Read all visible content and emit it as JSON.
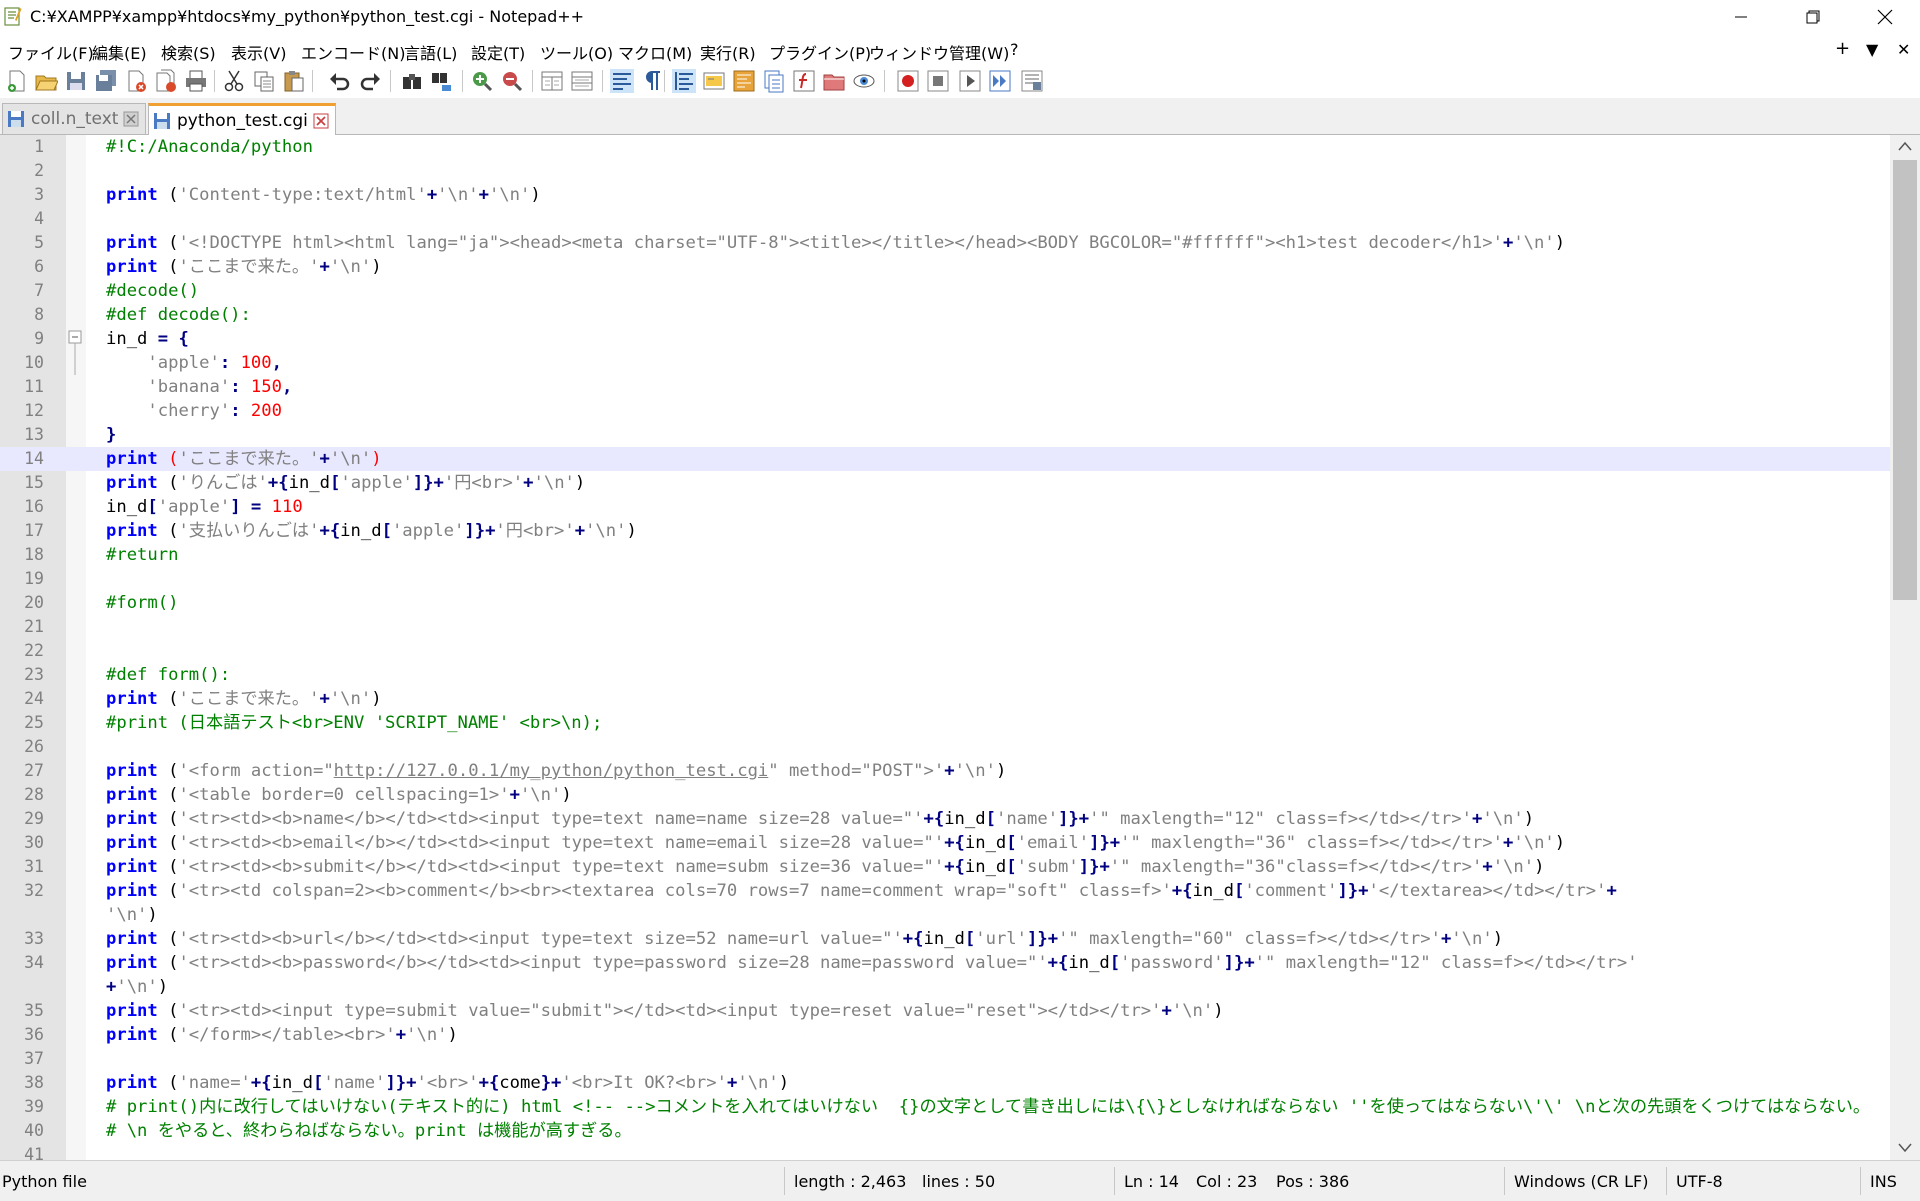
{
  "window": {
    "title": "C:¥XAMPP¥xampp¥htdocs¥my_python¥python_test.cgi - Notepad++",
    "minimize_icon": "minimize-icon",
    "maximize_icon": "restore-icon",
    "close_icon": "close-icon"
  },
  "menu": {
    "items": [
      "ファイル(F)",
      "編集(E)",
      "検索(S)",
      "表示(V)",
      "エンコード(N)",
      "言語(L)",
      "設定(T)",
      "ツール(O)",
      "マクロ(M)",
      "実行(R)",
      "プラグイン(P)",
      "ウィンドウ管理(W)",
      "?"
    ],
    "right_plus": "+",
    "right_down": "▼",
    "right_close": "✕"
  },
  "toolbar": {
    "icons": [
      "new-file-icon",
      "open-file-icon",
      "save-icon",
      "save-all-icon",
      "close-icon",
      "close-all-icon",
      "print-icon",
      "cut-icon",
      "copy-icon",
      "paste-icon",
      "undo-icon",
      "redo-icon",
      "find-icon",
      "replace-icon",
      "zoom-in-icon",
      "zoom-out-icon",
      "sync-vertical-icon",
      "sync-horizontal-icon",
      "word-wrap-icon",
      "show-all-chars-icon",
      "indent-guide-icon",
      "language-udl-icon",
      "doc-map-icon",
      "doc-list-icon",
      "function-list-icon",
      "folder-workspace-icon",
      "monitoring-icon",
      "record-macro-icon",
      "stop-record-icon",
      "play-macro-icon",
      "run-macro-multiple-icon",
      "save-macro-icon"
    ]
  },
  "tabs": [
    {
      "label": "coll.n_text",
      "active": false
    },
    {
      "label": "python_test.cgi",
      "active": true
    }
  ],
  "editor": {
    "current_line": 14,
    "fold_start_line": 9,
    "lines": [
      {
        "n": "1",
        "segs": [
          [
            "cm",
            "#!C:/Anaconda/python"
          ]
        ]
      },
      {
        "n": "2",
        "segs": []
      },
      {
        "n": "3",
        "segs": [
          [
            "kw",
            "print"
          ],
          [
            "df",
            " ("
          ],
          [
            "st",
            "'Content-type:text/html'"
          ],
          [
            "op",
            "+"
          ],
          [
            "st",
            "'\\n'"
          ],
          [
            "op",
            "+"
          ],
          [
            "st",
            "'\\n'"
          ],
          [
            "df",
            ")"
          ]
        ]
      },
      {
        "n": "4",
        "segs": []
      },
      {
        "n": "5",
        "segs": [
          [
            "kw",
            "print"
          ],
          [
            "df",
            " ("
          ],
          [
            "st",
            "'<!DOCTYPE html><html lang=\"ja\"><head><meta charset=\"UTF-8\"><title></title></head><BODY BGCOLOR=\"#ffffff\"><h1>test decoder</h1>'"
          ],
          [
            "op",
            "+"
          ],
          [
            "st",
            "'\\n'"
          ],
          [
            "df",
            ")"
          ]
        ]
      },
      {
        "n": "6",
        "segs": [
          [
            "kw",
            "print"
          ],
          [
            "df",
            " ("
          ],
          [
            "st",
            "'ここまで来た。'"
          ],
          [
            "op",
            "+"
          ],
          [
            "st",
            "'\\n'"
          ],
          [
            "df",
            ")"
          ]
        ]
      },
      {
        "n": "7",
        "segs": [
          [
            "cm",
            "#decode()"
          ]
        ]
      },
      {
        "n": "8",
        "segs": [
          [
            "cm",
            "#def decode():"
          ]
        ]
      },
      {
        "n": "9",
        "segs": [
          [
            "df",
            "in_d "
          ],
          [
            "op",
            "="
          ],
          [
            "df",
            " "
          ],
          [
            "op",
            "{"
          ]
        ]
      },
      {
        "n": "10",
        "segs": [
          [
            "df",
            "    "
          ],
          [
            "st",
            "'apple'"
          ],
          [
            "op",
            ":"
          ],
          [
            "df",
            " "
          ],
          [
            "nm",
            "100"
          ],
          [
            "op",
            ","
          ]
        ]
      },
      {
        "n": "11",
        "segs": [
          [
            "df",
            "    "
          ],
          [
            "st",
            "'banana'"
          ],
          [
            "op",
            ":"
          ],
          [
            "df",
            " "
          ],
          [
            "nm",
            "150"
          ],
          [
            "op",
            ","
          ]
        ]
      },
      {
        "n": "12",
        "segs": [
          [
            "df",
            "    "
          ],
          [
            "st",
            "'cherry'"
          ],
          [
            "op",
            ":"
          ],
          [
            "df",
            " "
          ],
          [
            "nm",
            "200"
          ]
        ]
      },
      {
        "n": "13",
        "segs": [
          [
            "op",
            "}"
          ]
        ]
      },
      {
        "n": "14",
        "segs": [
          [
            "kw",
            "print"
          ],
          [
            "df",
            " "
          ],
          [
            "br",
            "("
          ],
          [
            "st",
            "'ここまで来た。'"
          ],
          [
            "op",
            "+"
          ],
          [
            "st",
            "'\\n'"
          ],
          [
            "br",
            ")"
          ]
        ]
      },
      {
        "n": "15",
        "segs": [
          [
            "kw",
            "print"
          ],
          [
            "df",
            " ("
          ],
          [
            "st",
            "'りんごは'"
          ],
          [
            "op",
            "+{"
          ],
          [
            "df",
            "in_d"
          ],
          [
            "op",
            "["
          ],
          [
            "st",
            "'apple'"
          ],
          [
            "op",
            "]}+"
          ],
          [
            "st",
            "'円<br>'"
          ],
          [
            "op",
            "+"
          ],
          [
            "st",
            "'\\n'"
          ],
          [
            "df",
            ")"
          ]
        ]
      },
      {
        "n": "16",
        "segs": [
          [
            "df",
            "in_d"
          ],
          [
            "op",
            "["
          ],
          [
            "st",
            "'apple'"
          ],
          [
            "op",
            "]"
          ],
          [
            "df",
            " "
          ],
          [
            "op",
            "="
          ],
          [
            "df",
            " "
          ],
          [
            "nm",
            "110"
          ]
        ]
      },
      {
        "n": "17",
        "segs": [
          [
            "kw",
            "print"
          ],
          [
            "df",
            " ("
          ],
          [
            "st",
            "'支払いりんごは'"
          ],
          [
            "op",
            "+{"
          ],
          [
            "df",
            "in_d"
          ],
          [
            "op",
            "["
          ],
          [
            "st",
            "'apple'"
          ],
          [
            "op",
            "]}+"
          ],
          [
            "st",
            "'円<br>'"
          ],
          [
            "op",
            "+"
          ],
          [
            "st",
            "'\\n'"
          ],
          [
            "df",
            ")"
          ]
        ]
      },
      {
        "n": "18",
        "segs": [
          [
            "cm",
            "#return"
          ]
        ]
      },
      {
        "n": "19",
        "segs": []
      },
      {
        "n": "20",
        "segs": [
          [
            "cm",
            "#form()"
          ]
        ]
      },
      {
        "n": "21",
        "segs": []
      },
      {
        "n": "22",
        "segs": []
      },
      {
        "n": "23",
        "segs": [
          [
            "cm",
            "#def form():"
          ]
        ]
      },
      {
        "n": "24",
        "segs": [
          [
            "kw",
            "print"
          ],
          [
            "df",
            " ("
          ],
          [
            "st",
            "'ここまで来た。'"
          ],
          [
            "op",
            "+"
          ],
          [
            "st",
            "'\\n'"
          ],
          [
            "df",
            ")"
          ]
        ]
      },
      {
        "n": "25",
        "segs": [
          [
            "cm",
            "#print (日本語テスト<br>ENV 'SCRIPT_NAME' <br>\\n);"
          ]
        ]
      },
      {
        "n": "26",
        "segs": []
      },
      {
        "n": "27",
        "segs": [
          [
            "kw",
            "print"
          ],
          [
            "df",
            " ("
          ],
          [
            "st",
            "'<form action=\""
          ],
          [
            "ul",
            "http://127.0.0.1/my_python/python_test.cgi"
          ],
          [
            "st",
            "\" method=\"POST\">'"
          ],
          [
            "op",
            "+"
          ],
          [
            "st",
            "'\\n'"
          ],
          [
            "df",
            ")"
          ]
        ]
      },
      {
        "n": "28",
        "segs": [
          [
            "kw",
            "print"
          ],
          [
            "df",
            " ("
          ],
          [
            "st",
            "'<table border=0 cellspacing=1>'"
          ],
          [
            "op",
            "+"
          ],
          [
            "st",
            "'\\n'"
          ],
          [
            "df",
            ")"
          ]
        ]
      },
      {
        "n": "29",
        "segs": [
          [
            "kw",
            "print"
          ],
          [
            "df",
            " ("
          ],
          [
            "st",
            "'<tr><td><b>name</b></td><td><input type=text name=name size=28 value=\"'"
          ],
          [
            "op",
            "+{"
          ],
          [
            "df",
            "in_d"
          ],
          [
            "op",
            "["
          ],
          [
            "st",
            "'name'"
          ],
          [
            "op",
            "]}+"
          ],
          [
            "st",
            "'\" maxlength=\"12\" class=f></td></tr>'"
          ],
          [
            "op",
            "+"
          ],
          [
            "st",
            "'\\n'"
          ],
          [
            "df",
            ")"
          ]
        ]
      },
      {
        "n": "30",
        "segs": [
          [
            "kw",
            "print"
          ],
          [
            "df",
            " ("
          ],
          [
            "st",
            "'<tr><td><b>email</b></td><td><input type=text name=email size=28 value=\"'"
          ],
          [
            "op",
            "+{"
          ],
          [
            "df",
            "in_d"
          ],
          [
            "op",
            "["
          ],
          [
            "st",
            "'email'"
          ],
          [
            "op",
            "]}+"
          ],
          [
            "st",
            "'\" maxlength=\"36\" class=f></td></tr>'"
          ],
          [
            "op",
            "+"
          ],
          [
            "st",
            "'\\n'"
          ],
          [
            "df",
            ")"
          ]
        ]
      },
      {
        "n": "31",
        "segs": [
          [
            "kw",
            "print"
          ],
          [
            "df",
            " ("
          ],
          [
            "st",
            "'<tr><td><b>submit</b></td><td><input type=text name=subm size=36 value=\"'"
          ],
          [
            "op",
            "+{"
          ],
          [
            "df",
            "in_d"
          ],
          [
            "op",
            "["
          ],
          [
            "st",
            "'subm'"
          ],
          [
            "op",
            "]}+"
          ],
          [
            "st",
            "'\" maxlength=\"36\"class=f></td></tr>'"
          ],
          [
            "op",
            "+"
          ],
          [
            "st",
            "'\\n'"
          ],
          [
            "df",
            ")"
          ]
        ]
      },
      {
        "n": "32",
        "segs": [
          [
            "kw",
            "print"
          ],
          [
            "df",
            " ("
          ],
          [
            "st",
            "'<tr><td colspan=2><b>comment</b><br><textarea cols=70 rows=7 name=comment wrap=\"soft\" class=f>'"
          ],
          [
            "op",
            "+{"
          ],
          [
            "df",
            "in_d"
          ],
          [
            "op",
            "["
          ],
          [
            "st",
            "'comment'"
          ],
          [
            "op",
            "]}+"
          ],
          [
            "st",
            "'</textarea></td></tr>'"
          ],
          [
            "op",
            "+"
          ]
        ]
      },
      {
        "n": "",
        "segs": [
          [
            "st",
            "'\\n'"
          ],
          [
            "df",
            ")"
          ]
        ]
      },
      {
        "n": "33",
        "segs": [
          [
            "kw",
            "print"
          ],
          [
            "df",
            " ("
          ],
          [
            "st",
            "'<tr><td><b>url</b></td><td><input type=text size=52 name=url value=\"'"
          ],
          [
            "op",
            "+{"
          ],
          [
            "df",
            "in_d"
          ],
          [
            "op",
            "["
          ],
          [
            "st",
            "'url'"
          ],
          [
            "op",
            "]}+"
          ],
          [
            "st",
            "'\" maxlength=\"60\" class=f></td></tr>'"
          ],
          [
            "op",
            "+"
          ],
          [
            "st",
            "'\\n'"
          ],
          [
            "df",
            ")"
          ]
        ]
      },
      {
        "n": "34",
        "segs": [
          [
            "kw",
            "print"
          ],
          [
            "df",
            " ("
          ],
          [
            "st",
            "'<tr><td><b>password</b></td><td><input type=password size=28 name=password value=\"'"
          ],
          [
            "op",
            "+{"
          ],
          [
            "df",
            "in_d"
          ],
          [
            "op",
            "["
          ],
          [
            "st",
            "'password'"
          ],
          [
            "op",
            "]}+"
          ],
          [
            "st",
            "'\" maxlength=\"12\" class=f></td></tr>'"
          ]
        ]
      },
      {
        "n": "",
        "segs": [
          [
            "op",
            "+"
          ],
          [
            "st",
            "'\\n'"
          ],
          [
            "df",
            ")"
          ]
        ]
      },
      {
        "n": "35",
        "segs": [
          [
            "kw",
            "print"
          ],
          [
            "df",
            " ("
          ],
          [
            "st",
            "'<tr><td><input type=submit value=\"submit\"></td><td><input type=reset value=\"reset\"></td></tr>'"
          ],
          [
            "op",
            "+"
          ],
          [
            "st",
            "'\\n'"
          ],
          [
            "df",
            ")"
          ]
        ]
      },
      {
        "n": "36",
        "segs": [
          [
            "kw",
            "print"
          ],
          [
            "df",
            " ("
          ],
          [
            "st",
            "'</form></table><br>'"
          ],
          [
            "op",
            "+"
          ],
          [
            "st",
            "'\\n'"
          ],
          [
            "df",
            ")"
          ]
        ]
      },
      {
        "n": "37",
        "segs": []
      },
      {
        "n": "38",
        "segs": [
          [
            "kw",
            "print"
          ],
          [
            "df",
            " ("
          ],
          [
            "st",
            "'name='"
          ],
          [
            "op",
            "+{"
          ],
          [
            "df",
            "in_d"
          ],
          [
            "op",
            "["
          ],
          [
            "st",
            "'name'"
          ],
          [
            "op",
            "]}+"
          ],
          [
            "st",
            "'<br>'"
          ],
          [
            "op",
            "+{"
          ],
          [
            "df",
            "come"
          ],
          [
            "op",
            "}+"
          ],
          [
            "st",
            "'<br>It OK?<br>'"
          ],
          [
            "op",
            "+"
          ],
          [
            "st",
            "'\\n'"
          ],
          [
            "df",
            ")"
          ]
        ]
      },
      {
        "n": "39",
        "segs": [
          [
            "cm",
            "# print()内に改行してはいけない(テキスト的に) html <!-- -->コメントを入れてはいけない  {}の文字として書き出しには\\{\\}としなければならない ''を使ってはならない\\'\\' \\nと次の先頭をくつけてはならない。"
          ]
        ]
      },
      {
        "n": "40",
        "segs": [
          [
            "cm",
            "# \\n をやると、終わらねばならない。print は機能が高すぎる。"
          ]
        ]
      },
      {
        "n": "41",
        "segs": []
      }
    ]
  },
  "status": {
    "language": "Python file",
    "length": "length : 2,463",
    "lines": "lines : 50",
    "ln": "Ln : 14",
    "col": "Col : 23",
    "pos": "Pos : 386",
    "eol": "Windows (CR LF)",
    "encoding": "UTF-8",
    "mode": "INS"
  }
}
